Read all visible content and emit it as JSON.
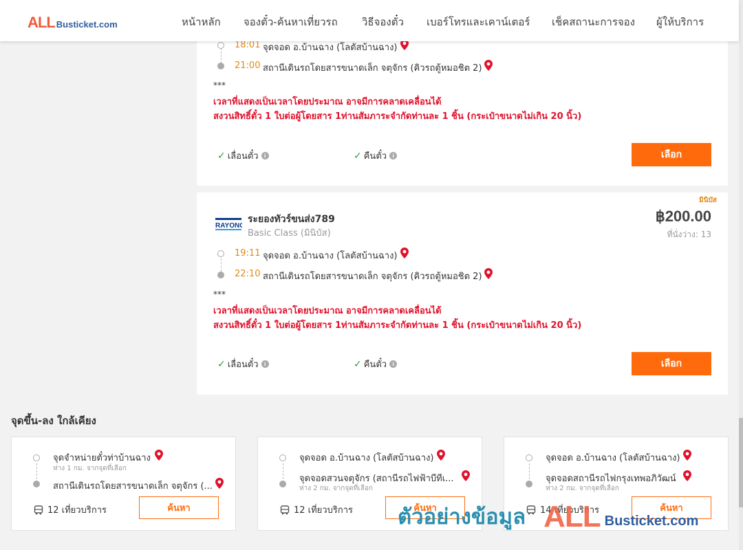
{
  "header": {
    "logo_all": "ALL",
    "logo_busticket": "Busticket.com",
    "nav": [
      "หน้าหลัก",
      "จองตั๋ว-ค้นหาเที่ยวรถ",
      "วิธีจองตั๋ว",
      "เบอร์โทรและเคาน์เตอร์",
      "เช็คสถานะการจอง",
      "ผู้ให้บริการ"
    ]
  },
  "trips": [
    {
      "departure_time": "18:01",
      "departure_stop": "จุดจอด อ.บ้านฉาง (โลตัสบ้านฉาง)",
      "arrival_time": "21:00",
      "arrival_stop": "สถานีเดินรถโดยสารขนาดเล็ก จตุจักร (คิวรถตู้หมอชิต 2)",
      "stars": "***",
      "notice_1": "เวลาที่แสดงเป็นเวลาโดยประมาณ อาจมีการคลาดเคลื่อนได้",
      "notice_2": "สงวนสิทธิ์ตั๋ว 1 ใบต่อผู้โดยสาร 1ท่านสัมภาระจำกัดท่านละ 1 ชิ้น (กระเป๋าขนาดไม่เกิน 20 นิ้ว)",
      "feature_postpone": "เลื่อนตั๋ว",
      "feature_refund": "คืนตั๋ว",
      "select_label": "เลือก"
    },
    {
      "ribbon": "มินิบัส",
      "company_logo_text": "RAYONG",
      "company": "ระยองทัวร์ขนส่ง789",
      "bus_class": "Basic Class (มินิบัส)",
      "price": "฿200.00",
      "seats": "ที่นั่งว่าง: 13",
      "departure_time": "19:11",
      "departure_stop": "จุดจอด อ.บ้านฉาง (โลตัสบ้านฉาง)",
      "arrival_time": "22:10",
      "arrival_stop": "สถานีเดินรถโดยสารขนาดเล็ก จตุจักร (คิวรถตู้หมอชิต 2)",
      "stars": "***",
      "notice_1": "เวลาที่แสดงเป็นเวลาโดยประมาณ อาจมีการคลาดเคลื่อนได้",
      "notice_2": "สงวนสิทธิ์ตั๋ว 1 ใบต่อผู้โดยสาร 1ท่านสัมภาระจำกัดท่านละ 1 ชิ้น (กระเป๋าขนาดไม่เกิน 20 นิ้ว)",
      "feature_postpone": "เลื่อนตั๋ว",
      "feature_refund": "คืนตั๋ว",
      "select_label": "เลือก"
    }
  ],
  "nearby": {
    "title": "จุดขึ้น-ลง ใกล้เคียง",
    "routes": [
      {
        "from": "จุดจำหน่ายตั๋วท่าบ้านฉาง",
        "from_distance": "ห่าง 1 กม. จากจุดที่เลือก",
        "to": "สถานีเดินรถโดยสารขนาดเล็ก จตุจักร (...",
        "to_distance": "",
        "trips": "12 เที่ยวบริการ",
        "search_label": "ค้นหา"
      },
      {
        "from": "จุดจอด อ.บ้านฉาง (โลตัสบ้านฉาง)",
        "from_distance": "",
        "to": "จุดจอดสวนจตุจักร (สถานีรถไฟฟ้าบีทีเ...",
        "to_distance": "ห่าง 2 กม. จากจุดที่เลือก",
        "trips": "12 เที่ยวบริการ",
        "search_label": "ค้นหา"
      },
      {
        "from": "จุดจอด อ.บ้านฉาง (โลตัสบ้านฉาง)",
        "from_distance": "",
        "to": "จุดจอดสถานีรถไฟกรุงเทพอภิวัฒน์",
        "to_distance": "ห่าง 2 กม. จากจุดที่เลือก",
        "trips": "14 เที่ยวบริการ",
        "search_label": "ค้นหา"
      }
    ]
  },
  "watermark": {
    "text_th": "ตัวอย่างข้อมูล",
    "all": "ALL",
    "busticket": "Busticket.com"
  },
  "colors": {
    "accent": "#ff6b0c",
    "time": "#e08a12",
    "notice": "#e0112b",
    "pin": "#e0112b",
    "check": "#2e9e3b"
  },
  "icons": [
    "map-pin-icon",
    "check-icon",
    "info-icon",
    "bus-icon"
  ]
}
